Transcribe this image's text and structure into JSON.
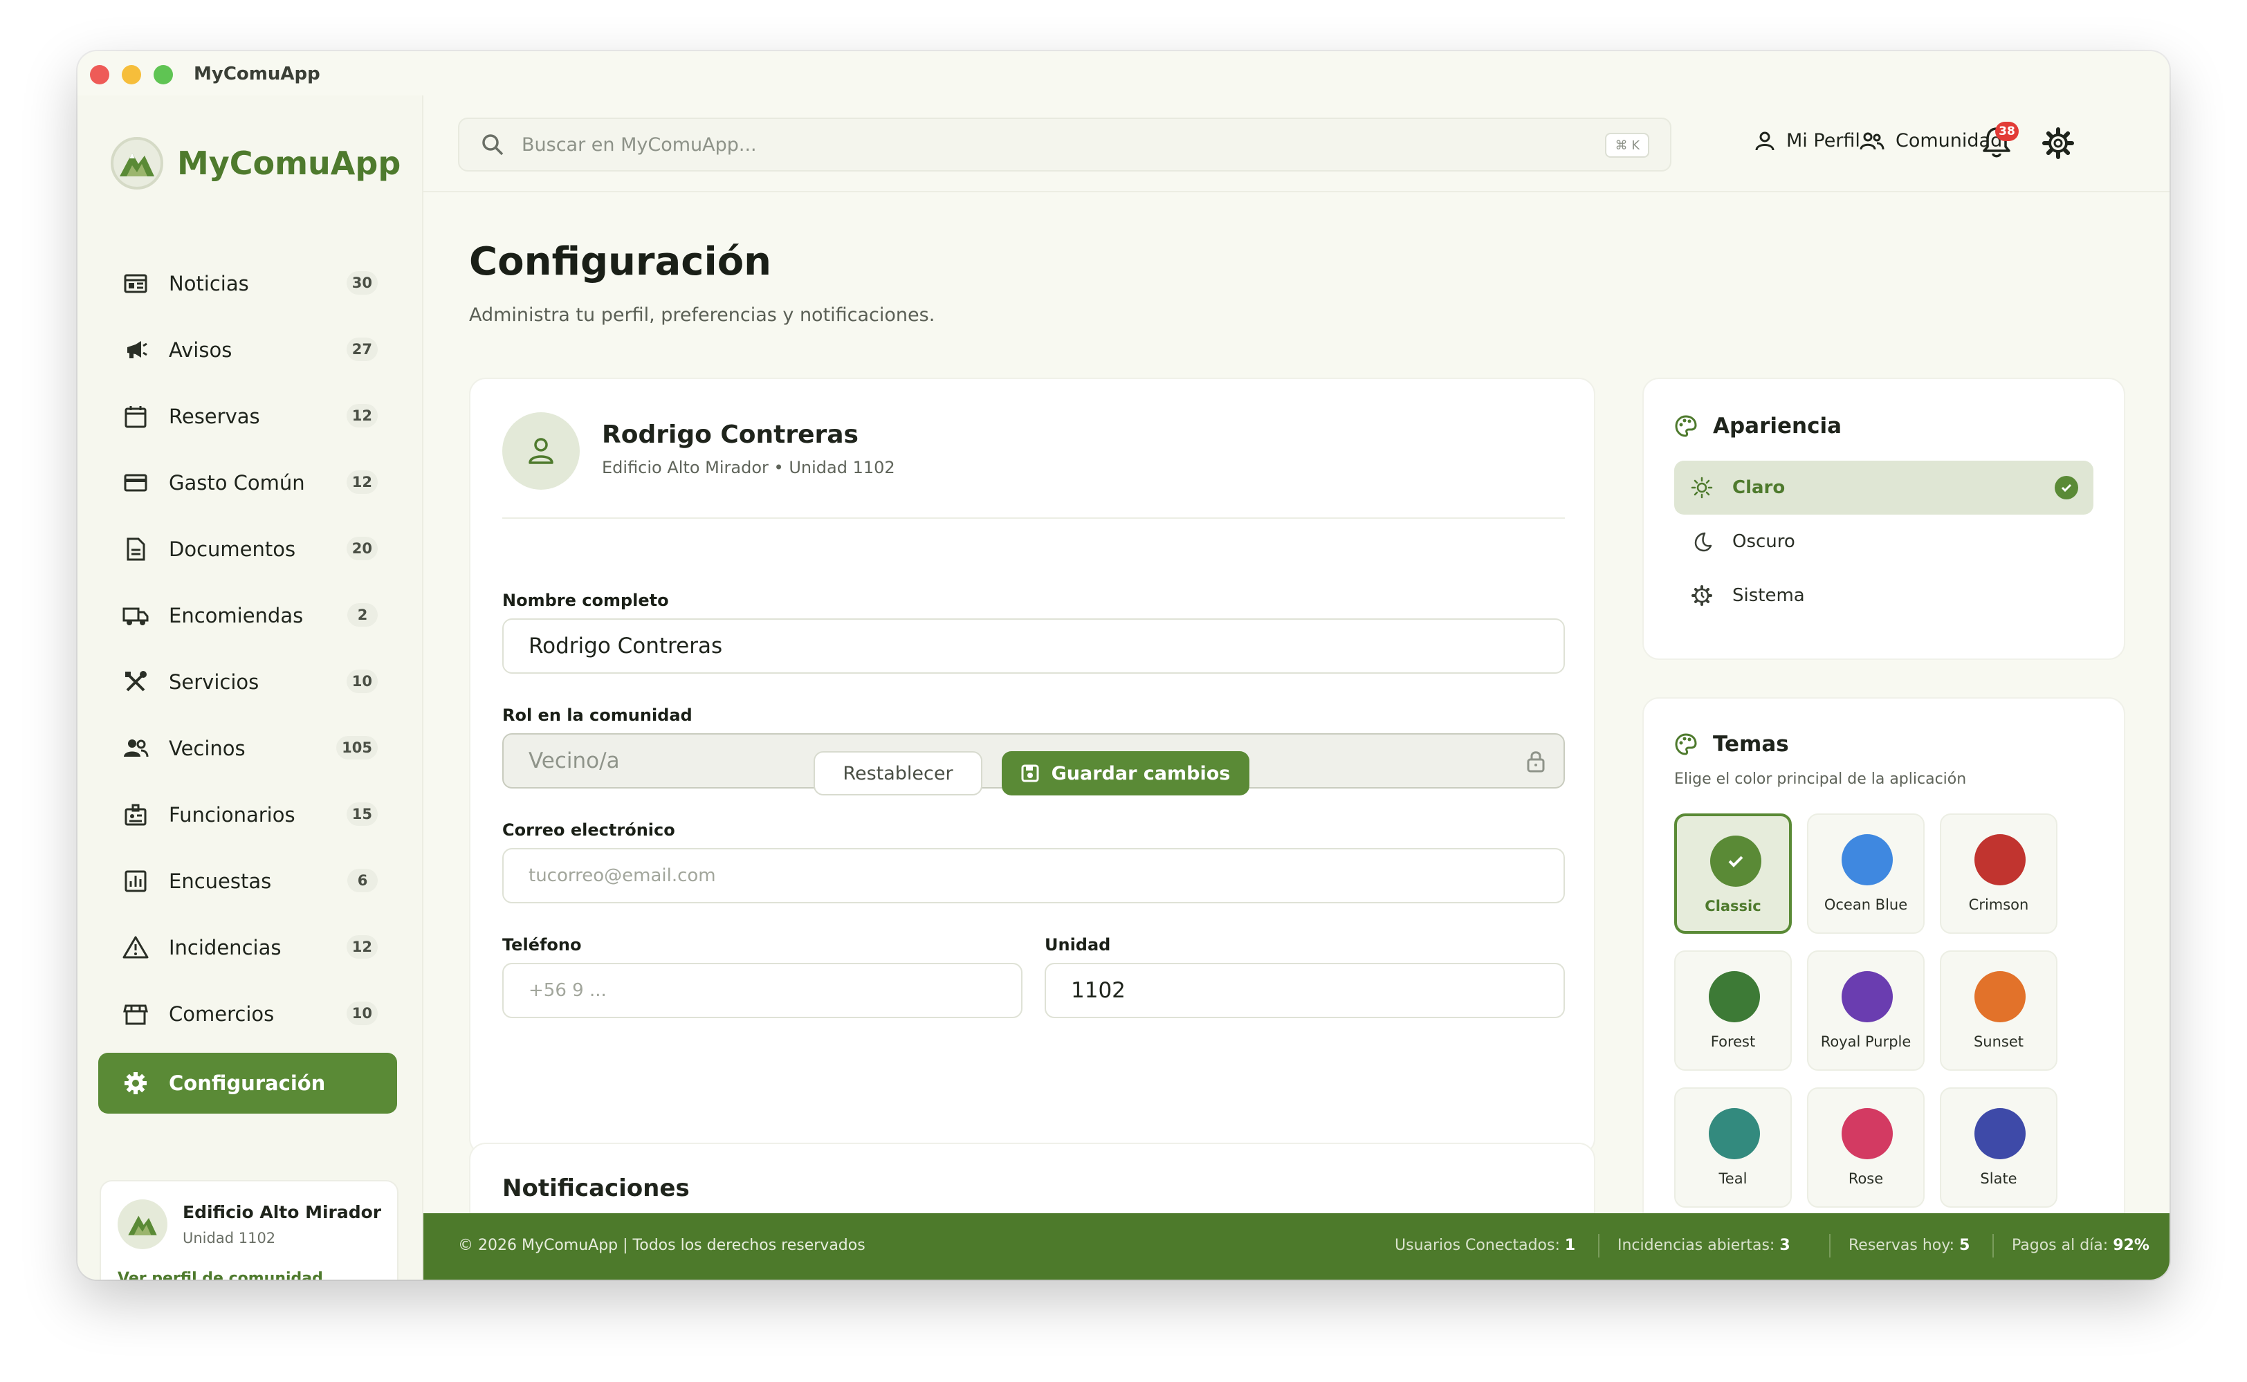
{
  "window": {
    "title": "MyComuApp"
  },
  "brand": {
    "name": "MyComuApp"
  },
  "sidebar": {
    "items": [
      {
        "label": "Noticias",
        "count": "30",
        "icon": "newspaper-icon"
      },
      {
        "label": "Avisos",
        "count": "27",
        "icon": "megaphone-icon"
      },
      {
        "label": "Reservas",
        "count": "12",
        "icon": "calendar-icon"
      },
      {
        "label": "Gasto Común",
        "count": "12",
        "icon": "credit-card-icon"
      },
      {
        "label": "Documentos",
        "count": "20",
        "icon": "document-icon"
      },
      {
        "label": "Encomiendas",
        "count": "2",
        "icon": "truck-icon"
      },
      {
        "label": "Servicios",
        "count": "10",
        "icon": "tools-icon"
      },
      {
        "label": "Vecinos",
        "count": "105",
        "icon": "people-icon"
      },
      {
        "label": "Funcionarios",
        "count": "15",
        "icon": "id-badge-icon"
      },
      {
        "label": "Encuestas",
        "count": "6",
        "icon": "bar-chart-icon"
      },
      {
        "label": "Incidencias",
        "count": "12",
        "icon": "warning-icon"
      },
      {
        "label": "Comercios",
        "count": "10",
        "icon": "store-icon"
      },
      {
        "label": "Configuración",
        "icon": "gear-icon",
        "active": true
      }
    ],
    "community": {
      "name": "Edificio Alto Mirador",
      "unit": "Unidad 1102",
      "link": "Ver perfil de comunidad"
    }
  },
  "topbar": {
    "search_placeholder": "Buscar en MyComuApp...",
    "shortcut": "⌘ K",
    "profile_label": "Mi Perfil",
    "community_label": "Comunidad",
    "notifications_count": "38"
  },
  "page": {
    "title": "Configuración",
    "subtitle": "Administra tu perfil, preferencias y notificaciones."
  },
  "profile": {
    "name": "Rodrigo Contreras",
    "meta": "Edificio Alto Mirador • Unidad 1102",
    "fields": {
      "name_label": "Nombre completo",
      "name_value": "Rodrigo Contreras",
      "role_label": "Rol en la comunidad",
      "role_value": "Vecino/a",
      "email_label": "Correo electrónico",
      "email_placeholder": "tucorreo@email.com",
      "phone_label": "Teléfono",
      "phone_placeholder": "+56 9 ...",
      "unit_label": "Unidad",
      "unit_value": "1102"
    },
    "reset_label": "Restablecer",
    "save_label": "Guardar cambios"
  },
  "notifications": {
    "title": "Notificaciones"
  },
  "appearance": {
    "title": "Apariencia",
    "options": [
      {
        "label": "Claro",
        "icon": "sun-icon",
        "selected": true
      },
      {
        "label": "Oscuro",
        "icon": "moon-icon"
      },
      {
        "label": "Sistema",
        "icon": "system-icon"
      }
    ]
  },
  "themes": {
    "title": "Temas",
    "subtitle": "Elige el color principal de la aplicación",
    "items": [
      {
        "name": "Classic",
        "color": "#5a8a36",
        "selected": true
      },
      {
        "name": "Ocean Blue",
        "color": "#3f88e0"
      },
      {
        "name": "Crimson",
        "color": "#c1342f"
      },
      {
        "name": "Forest",
        "color": "#3d7a36"
      },
      {
        "name": "Royal Purple",
        "color": "#6a3db0"
      },
      {
        "name": "Sunset",
        "color": "#e2722a"
      },
      {
        "name": "Teal",
        "color": "#338a7e"
      },
      {
        "name": "Rose",
        "color": "#d33a62"
      },
      {
        "name": "Slate",
        "color": "#3e4aa8"
      }
    ]
  },
  "footer": {
    "copyright": "© 2026 MyComuApp | Todos los derechos reservados",
    "stats": [
      {
        "label": "Usuarios Conectados:",
        "value": "1"
      },
      {
        "label": "Incidencias abiertas:",
        "value": "3"
      },
      {
        "label": "Reservas hoy:",
        "value": "5"
      },
      {
        "label": "Pagos al día:",
        "value": "92%"
      }
    ]
  },
  "colors": {
    "accent": "#5a8a36",
    "footer": "#4d7a2b",
    "background": "#f8f9f1"
  }
}
